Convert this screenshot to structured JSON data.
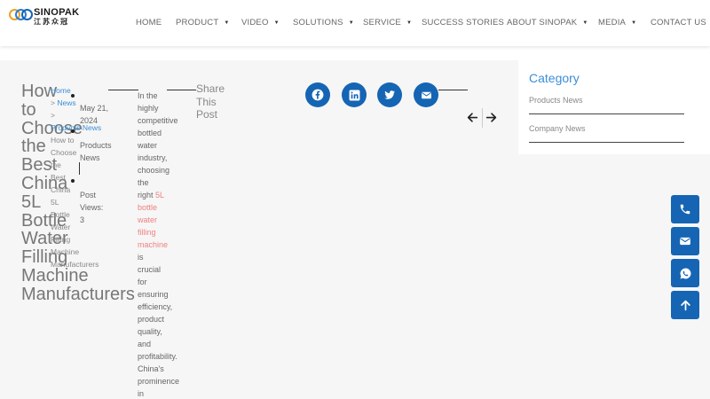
{
  "brand": {
    "name": "SINOPAK",
    "subtitle": "江苏众冠"
  },
  "nav": {
    "items": [
      {
        "label": "HOME",
        "has_dropdown": false
      },
      {
        "label": "PRODUCT",
        "has_dropdown": true
      },
      {
        "label": "VIDEO",
        "has_dropdown": true
      },
      {
        "label": "SOLUTIONS",
        "has_dropdown": true
      },
      {
        "label": "SERVICE",
        "has_dropdown": true
      },
      {
        "label": "SUCCESS STORIES",
        "has_dropdown": false
      },
      {
        "label": "ABOUT SINOPAK",
        "has_dropdown": true
      },
      {
        "label": "MEDIA",
        "has_dropdown": true
      },
      {
        "label": "CONTACT US",
        "has_dropdown": false
      }
    ]
  },
  "post": {
    "title_lines": [
      "How",
      "to",
      "Choose",
      "the",
      "Best",
      "China",
      "5L",
      "Bottle",
      "Water",
      "Filling",
      "Machine",
      "Manufacturers"
    ],
    "breadcrumb": {
      "home": "Home",
      "news": "News",
      "sep": ">",
      "products_news": "Products News",
      "current_lines": [
        "How to",
        "Choose",
        "the",
        "Best",
        "China",
        "5L",
        "Bottle",
        "Water",
        "Filling",
        "Machine",
        "Manufacturers"
      ]
    },
    "meta": {
      "date": "May 21, 2024",
      "category": "Products News",
      "views_label": "Post Views:",
      "views": "3"
    },
    "content": {
      "lines_before": [
        "In the",
        "highly",
        "competitive",
        "bottled",
        "water",
        "industry,",
        "choosing",
        "the"
      ],
      "right_word": "right",
      "link_inline": "5L",
      "link_lines": [
        "bottle",
        "water",
        "filling",
        "machine"
      ],
      "lines_after": [
        "is",
        "crucial",
        "for",
        "ensuring",
        "efficiency,",
        "product",
        "quality,",
        "and",
        "profitability.",
        "China's",
        "prominence",
        "in"
      ]
    },
    "share_lines": [
      "Share",
      "This",
      "Post"
    ]
  },
  "social_icons": [
    "facebook-icon",
    "linkedin-icon",
    "twitter-icon",
    "envelope-icon"
  ],
  "sidebar": {
    "category_title": "Category",
    "categories": [
      "Products News",
      "Company News"
    ]
  },
  "floating_buttons": [
    "phone-icon",
    "envelope-icon",
    "whatsapp-icon",
    "arrow-up-icon"
  ],
  "colors": {
    "accent": "#1565b4",
    "link": "#3a8fd6",
    "highlight": "#f08080"
  }
}
